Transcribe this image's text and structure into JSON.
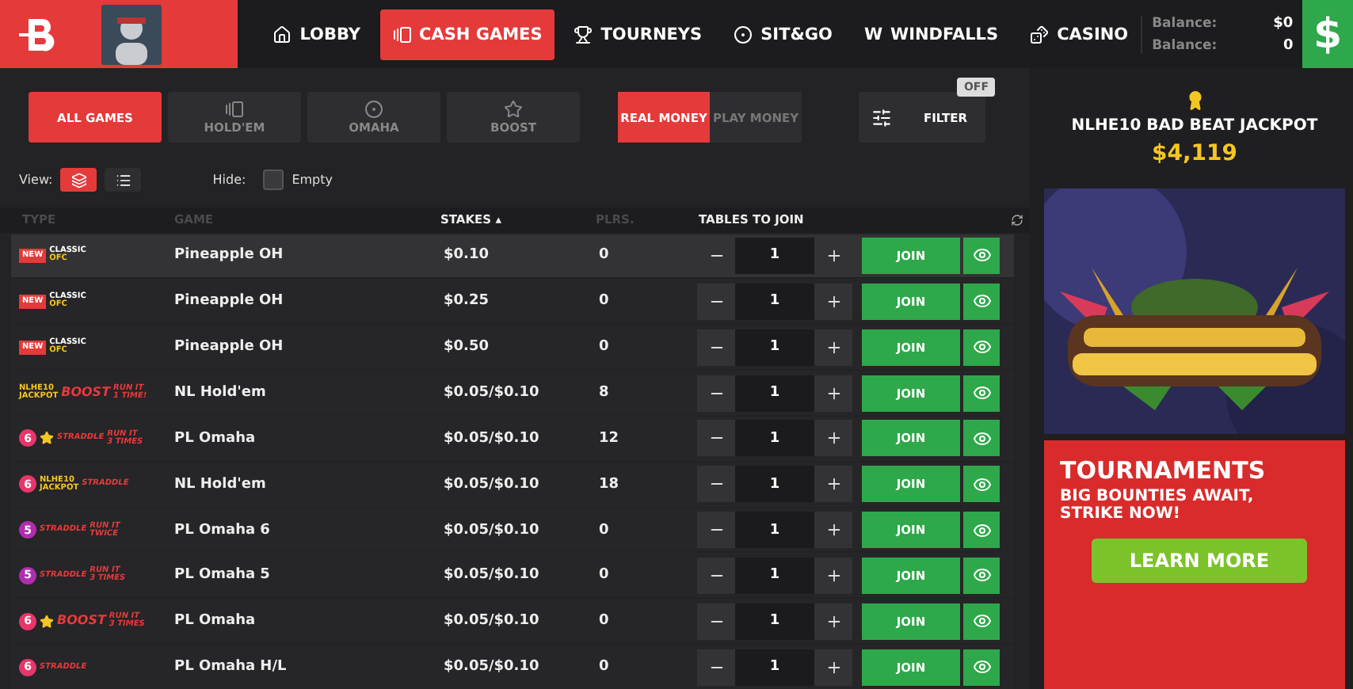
{
  "nav": {
    "items": [
      {
        "label": "LOBBY",
        "selected": false
      },
      {
        "label": "CASH GAMES",
        "selected": true
      },
      {
        "label": "TOURNEYS",
        "selected": false
      },
      {
        "label": "SIT&GO",
        "selected": false
      },
      {
        "label": "WINDFALLS",
        "icon_text": "W",
        "selected": false
      },
      {
        "label": "CASINO",
        "selected": false
      }
    ],
    "balances": [
      {
        "label": "Balance:",
        "value": "$0"
      },
      {
        "label": "Balance:",
        "value": "0"
      }
    ],
    "cashier": "$"
  },
  "game_filters": [
    {
      "label": "ALL GAMES",
      "selected": true
    },
    {
      "label": "HOLD'EM",
      "selected": false
    },
    {
      "label": "OMAHA",
      "selected": false
    },
    {
      "label": "BOOST",
      "selected": false
    }
  ],
  "money": [
    {
      "label": "REAL MONEY",
      "selected": true
    },
    {
      "label": "PLAY MONEY",
      "selected": false
    }
  ],
  "filter": {
    "label": "FILTER",
    "badge": "OFF"
  },
  "view": {
    "label": "View:",
    "options": [
      {
        "kind": "stack",
        "selected": true
      },
      {
        "kind": "list",
        "selected": false
      }
    ]
  },
  "hide": {
    "label": "Hide:",
    "option": "Empty",
    "checked": false
  },
  "columns": [
    {
      "label": "TYPE",
      "highlighted": false
    },
    {
      "label": "GAME",
      "highlighted": false
    },
    {
      "label": "STAKES",
      "highlighted": true,
      "sort": "▴"
    },
    {
      "label": "PLRS.",
      "highlighted": false
    },
    {
      "label": "TABLES TO JOIN",
      "highlighted": true
    }
  ],
  "rows": [
    {
      "selected": true,
      "tags": [
        {
          "kind": "new",
          "text": "NEW"
        },
        {
          "kind": "classic",
          "text": "CLASSIC",
          "sub": "OFC"
        }
      ],
      "game": "Pineapple OH",
      "stakes": "$0.10",
      "players": "0",
      "tables": "1",
      "join": "JOIN"
    },
    {
      "selected": false,
      "tags": [
        {
          "kind": "new",
          "text": "NEW"
        },
        {
          "kind": "classic",
          "text": "CLASSIC",
          "sub": "OFC"
        }
      ],
      "game": "Pineapple OH",
      "stakes": "$0.25",
      "players": "0",
      "tables": "1",
      "join": "JOIN"
    },
    {
      "selected": false,
      "tags": [
        {
          "kind": "new",
          "text": "NEW"
        },
        {
          "kind": "classic",
          "text": "CLASSIC",
          "sub": "OFC"
        }
      ],
      "game": "Pineapple OH",
      "stakes": "$0.50",
      "players": "0",
      "tables": "1",
      "join": "JOIN"
    },
    {
      "selected": false,
      "tags": [
        {
          "kind": "jackpot",
          "text": "NLHE10",
          "sub": "JACKPOT"
        },
        {
          "kind": "boost",
          "text": "BOOST"
        },
        {
          "kind": "runit",
          "text": "RUN IT",
          "sub": "1 TIME!"
        }
      ],
      "game": "NL Hold'em",
      "stakes": "$0.05/$0.10",
      "players": "8",
      "tables": "1",
      "join": "JOIN"
    },
    {
      "selected": false,
      "tags": [
        {
          "kind": "seats",
          "text": "6"
        },
        {
          "kind": "star"
        },
        {
          "kind": "straddle",
          "text": "STRADDLE"
        },
        {
          "kind": "runit",
          "text": "RUN IT",
          "sub": "3 TIMES"
        }
      ],
      "game": "PL Omaha",
      "stakes": "$0.05/$0.10",
      "players": "12",
      "tables": "1",
      "join": "JOIN"
    },
    {
      "selected": false,
      "tags": [
        {
          "kind": "seats",
          "text": "6"
        },
        {
          "kind": "jackpot",
          "text": "NLHE10",
          "sub": "JACKPOT"
        },
        {
          "kind": "straddle",
          "text": "STRADDLE"
        }
      ],
      "game": "NL Hold'em",
      "stakes": "$0.05/$0.10",
      "players": "18",
      "tables": "1",
      "join": "JOIN"
    },
    {
      "selected": false,
      "tags": [
        {
          "kind": "seats5",
          "text": "5"
        },
        {
          "kind": "straddle",
          "text": "STRADDLE"
        },
        {
          "kind": "runit",
          "text": "RUN IT",
          "sub": "TWICE"
        }
      ],
      "game": "PL Omaha 6",
      "stakes": "$0.05/$0.10",
      "players": "0",
      "tables": "1",
      "join": "JOIN"
    },
    {
      "selected": false,
      "tags": [
        {
          "kind": "seats5",
          "text": "5"
        },
        {
          "kind": "straddle",
          "text": "STRADDLE"
        },
        {
          "kind": "runit",
          "text": "RUN IT",
          "sub": "3 TIMES"
        }
      ],
      "game": "PL Omaha 5",
      "stakes": "$0.05/$0.10",
      "players": "0",
      "tables": "1",
      "join": "JOIN"
    },
    {
      "selected": false,
      "tags": [
        {
          "kind": "seats",
          "text": "6"
        },
        {
          "kind": "star"
        },
        {
          "kind": "boost",
          "text": "BOOST"
        },
        {
          "kind": "runit",
          "text": "RUN IT",
          "sub": "3 TIMES"
        }
      ],
      "game": "PL Omaha",
      "stakes": "$0.05/$0.10",
      "players": "0",
      "tables": "1",
      "join": "JOIN"
    },
    {
      "selected": false,
      "tags": [
        {
          "kind": "seats",
          "text": "6"
        },
        {
          "kind": "straddle",
          "text": "STRADDLE"
        }
      ],
      "game": "PL Omaha H/L",
      "stakes": "$0.05/$0.10",
      "players": "0",
      "tables": "1",
      "join": "JOIN"
    }
  ],
  "jackpot": {
    "title": "NLHE10 BAD BEAT JACKPOT",
    "amount": "$4,119"
  },
  "banner": {
    "title": "TOURNAMENTS",
    "text": "BIG BOUNTIES AWAIT, STRIKE NOW!",
    "button": "LEARN MORE"
  }
}
